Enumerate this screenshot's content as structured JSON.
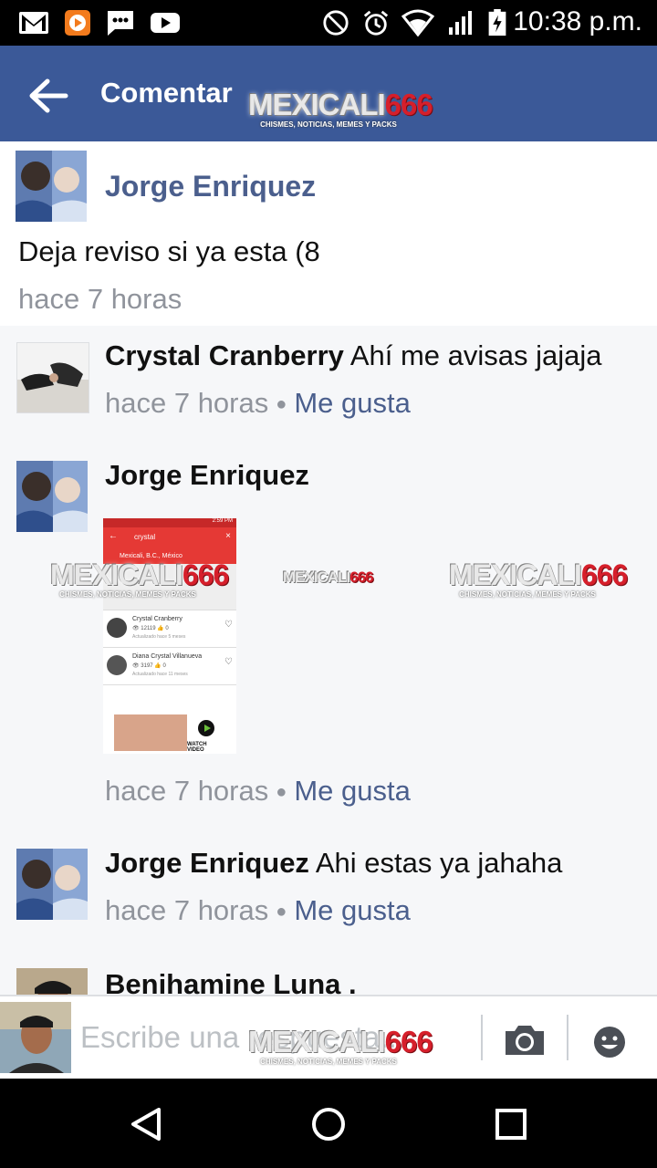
{
  "status_bar": {
    "time": "10:38 p.m.",
    "icons": [
      "gmail-icon",
      "play-music-icon",
      "messages-icon",
      "youtube-icon",
      "do-not-disturb-icon",
      "alarm-icon",
      "wifi-icon",
      "signal-icon",
      "battery-icon"
    ]
  },
  "app_bar": {
    "title": "Comentar"
  },
  "watermark": {
    "brand": "MEXICALI",
    "number": "666",
    "tagline": "CHISMES, NOTICIAS, MEMES Y PACKS"
  },
  "post": {
    "author": "Jorge Enriquez",
    "text": "Deja reviso si ya esta (8",
    "time": "hace 7 horas"
  },
  "comments": [
    {
      "author": "Crystal Cranberry",
      "text": "Ahí me avisas jajaja",
      "time": "hace 7 horas",
      "like": "Me gusta"
    },
    {
      "author": "Jorge Enriquez",
      "text": "",
      "time": "hace 7 horas",
      "like": "Me gusta",
      "attachment": {
        "search": "crystal",
        "location": "Mexicali, B.C., México",
        "results": [
          {
            "name": "Crystal Cranberry",
            "views": "12119",
            "likes": "0",
            "updated": "Actualizado hace 5 meses"
          },
          {
            "name": "Diana Crystal Villanueva",
            "views": "3197",
            "likes": "0",
            "updated": "Actualizado hace 11 meses"
          }
        ],
        "status_time": "2:59 PM",
        "video_label": "WATCH VIDEO"
      }
    },
    {
      "author": "Jorge Enriquez",
      "text": "Ahi estas ya jahaha",
      "time": "hace 7 horas",
      "like": "Me gusta"
    },
    {
      "author": "Benihamine Luna .",
      "text": "",
      "time": "",
      "like": ""
    }
  ],
  "composer": {
    "placeholder": "Escribe una respuesta..."
  },
  "colors": {
    "brand_blue": "#3b5998",
    "name_blue": "#4b5f8d",
    "meta_gray": "#90949c"
  }
}
